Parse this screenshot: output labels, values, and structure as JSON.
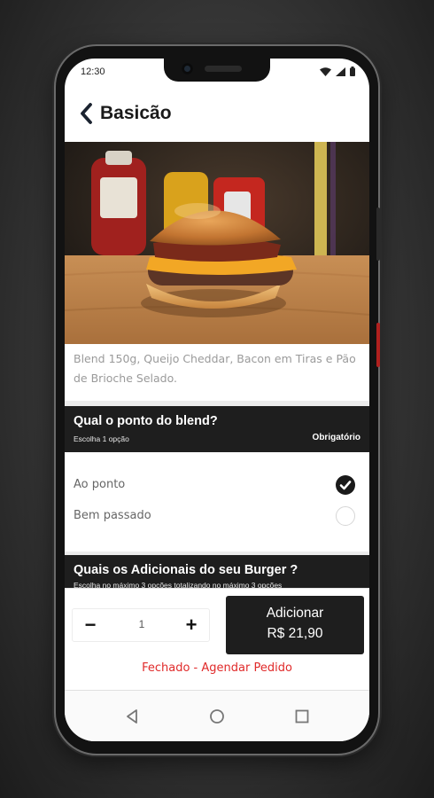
{
  "status_bar": {
    "time": "12:30",
    "icons": [
      "wifi-icon",
      "signal-icon",
      "battery-icon"
    ]
  },
  "header": {
    "title": "Basicão",
    "back_icon": "chevron-left-icon"
  },
  "product": {
    "description": "Blend 150g, Queijo Cheddar, Bacon em Tiras e Pão de Brioche Selado."
  },
  "sections": [
    {
      "title": "Qual o ponto do blend?",
      "subtitle": "Escolha 1 opção",
      "badge": "Obrigatório",
      "options": [
        {
          "label": "Ao ponto",
          "selected": true
        },
        {
          "label": "Bem passado",
          "selected": false
        }
      ]
    },
    {
      "title": "Quais os Adicionais do seu Burger ?",
      "subtitle": "Escolha no máximo 3 opções totalizando no máximo 3 opções"
    }
  ],
  "cart": {
    "decrement": "−",
    "quantity": "1",
    "increment": "+",
    "add_label": "Adicionar",
    "price": "R$ 21,90"
  },
  "status_link": "Fechado - Agendar Pedido",
  "colors": {
    "dark": "#1e1e1e",
    "accent_red": "#e02a2a",
    "text_gray": "#9a9a9a"
  },
  "nav_bar": {
    "icons": [
      "back-triangle-icon",
      "home-circle-icon",
      "recents-square-icon"
    ]
  }
}
